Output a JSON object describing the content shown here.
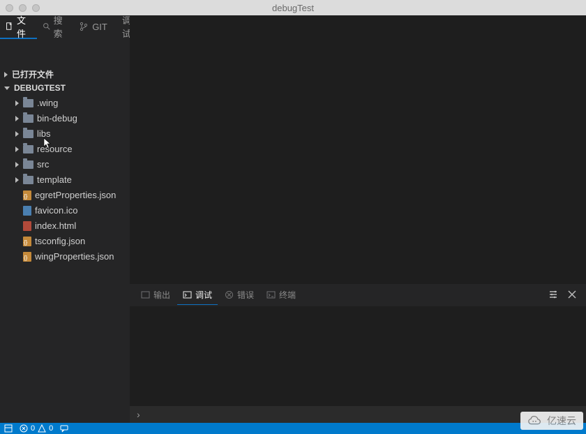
{
  "window": {
    "title": "debugTest"
  },
  "top_tabs": [
    {
      "label": "文件",
      "icon": "file-icon",
      "active": true
    },
    {
      "label": "搜索",
      "icon": "search-icon",
      "active": false
    },
    {
      "label": "GIT",
      "icon": "branch-icon",
      "active": false
    },
    {
      "label": "调试",
      "icon": "bug-icon",
      "active": false
    }
  ],
  "explorer": {
    "open_editors_label": "已打开文件",
    "project_label": "DEBUGTEST",
    "items": [
      {
        "kind": "folder",
        "label": ".wing"
      },
      {
        "kind": "folder",
        "label": "bin-debug"
      },
      {
        "kind": "folder",
        "label": "libs"
      },
      {
        "kind": "folder",
        "label": "resource"
      },
      {
        "kind": "folder",
        "label": "src"
      },
      {
        "kind": "folder",
        "label": "template"
      },
      {
        "kind": "file",
        "label": "egretProperties.json",
        "icon": "json"
      },
      {
        "kind": "file",
        "label": "favicon.ico",
        "icon": "ico"
      },
      {
        "kind": "file",
        "label": "index.html",
        "icon": "html"
      },
      {
        "kind": "file",
        "label": "tsconfig.json",
        "icon": "json"
      },
      {
        "kind": "file",
        "label": "wingProperties.json",
        "icon": "json"
      }
    ]
  },
  "panel_tabs": [
    {
      "label": "输出",
      "icon": "output-icon",
      "active": false
    },
    {
      "label": "调试",
      "icon": "console-icon",
      "active": true
    },
    {
      "label": "错误",
      "icon": "error-icon",
      "active": false
    },
    {
      "label": "终端",
      "icon": "terminal-icon",
      "active": false
    }
  ],
  "panel_input_prompt": "›",
  "statusbar": {
    "errors": "0",
    "warnings": "0"
  },
  "watermark_text": "亿速云"
}
